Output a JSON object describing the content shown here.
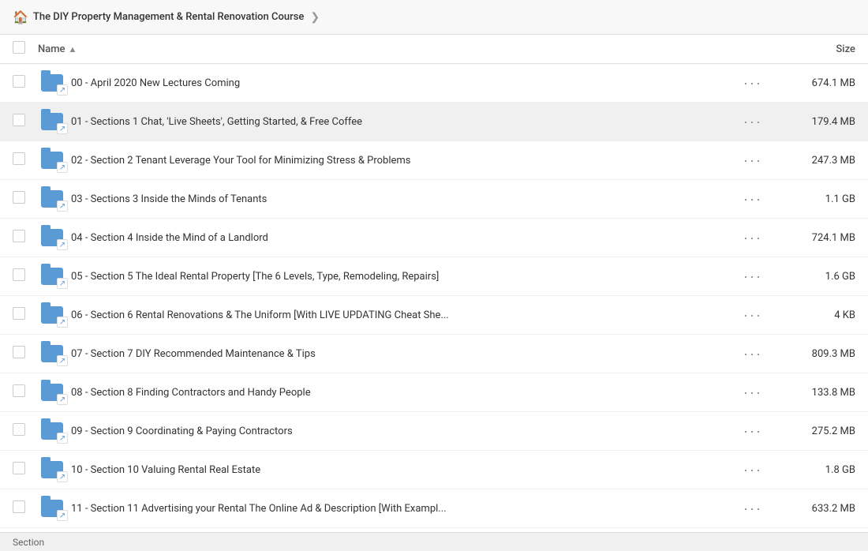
{
  "breadcrumb": {
    "icon": "🏠",
    "label": "The DIY Property Management & Rental Renovation Course",
    "arrow": "❯"
  },
  "header": {
    "checkbox_label": "",
    "name_col": "Name",
    "sort_icon": "▲",
    "size_col": "Size"
  },
  "rows": [
    {
      "id": 0,
      "name": "00 - April 2020 New Lectures Coming",
      "size": "674.1 MB",
      "highlighted": false
    },
    {
      "id": 1,
      "name": "01 - Sections 1 Chat, 'Live Sheets', Getting Started, & Free Coffee",
      "size": "179.4 MB",
      "highlighted": true
    },
    {
      "id": 2,
      "name": "02 - Section 2 Tenant Leverage Your Tool for Minimizing Stress & Problems",
      "size": "247.3 MB",
      "highlighted": false
    },
    {
      "id": 3,
      "name": "03 - Sections 3 Inside the Minds of Tenants",
      "size": "1.1 GB",
      "highlighted": false
    },
    {
      "id": 4,
      "name": "04 - Section 4 Inside the Mind of a Landlord",
      "size": "724.1 MB",
      "highlighted": false
    },
    {
      "id": 5,
      "name": "05 - Section 5 The Ideal Rental Property [The 6 Levels, Type, Remodeling, Repairs]",
      "size": "1.6 GB",
      "highlighted": false
    },
    {
      "id": 6,
      "name": "06 - Section 6 Rental Renovations & The Uniform [With LIVE UPDATING Cheat She...",
      "size": "4 KB",
      "highlighted": false
    },
    {
      "id": 7,
      "name": "07 - Section 7 DIY Recommended Maintenance & Tips",
      "size": "809.3 MB",
      "highlighted": false
    },
    {
      "id": 8,
      "name": "08 - Section 8 Finding Contractors and Handy People",
      "size": "133.8 MB",
      "highlighted": false
    },
    {
      "id": 9,
      "name": "09 - Section 9 Coordinating & Paying Contractors",
      "size": "275.2 MB",
      "highlighted": false
    },
    {
      "id": 10,
      "name": "10 - Section 10 Valuing Rental Real Estate",
      "size": "1.8 GB",
      "highlighted": false
    },
    {
      "id": 11,
      "name": "11 - Section 11 Advertising your Rental The Online Ad & Description [With Exampl...",
      "size": "633.2 MB",
      "highlighted": false
    }
  ],
  "status_bar": {
    "label": "Section"
  },
  "dots_label": "···"
}
